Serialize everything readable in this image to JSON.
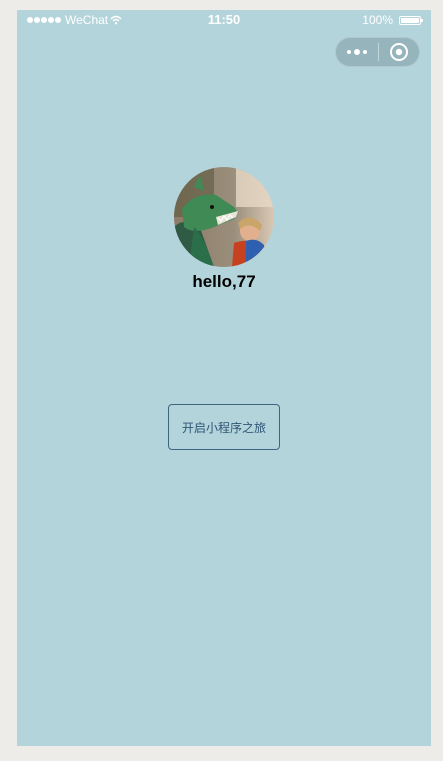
{
  "status_bar": {
    "carrier": "WeChat",
    "time": "11:50",
    "battery": "100%"
  },
  "capsule": {
    "menu_icon": "more-dots-icon",
    "close_icon": "target-circle-icon"
  },
  "user": {
    "greeting": "hello,77",
    "avatar": "user-avatar-image"
  },
  "start_button": {
    "label": "开启小程序之旅"
  },
  "colors": {
    "page_background": "#b3d4db",
    "outer_background": "#eeece8",
    "button_border": "#3f6680",
    "button_text": "#2f5675"
  }
}
